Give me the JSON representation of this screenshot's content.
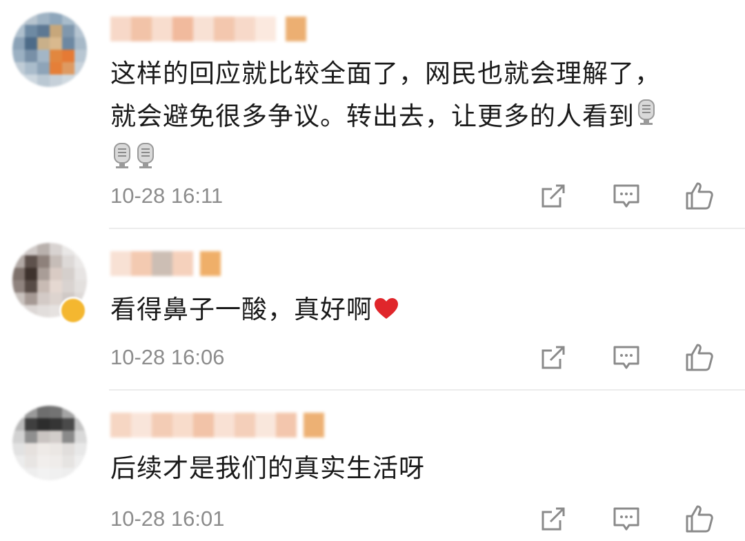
{
  "comments": [
    {
      "text_line1": "这样的回应就比较全面了，网民也就会理解了，",
      "text_line2": "就会避免很多争议。转出去，让更多的人看到",
      "mic_emoji_count": 3,
      "time": "10-28 16:11"
    },
    {
      "text": "看得鼻子一酸，真好啊",
      "emoji": "heart",
      "time": "10-28 16:06"
    },
    {
      "text": "后续才是我们的真实生活呀",
      "time": "10-28 16:01"
    }
  ],
  "icons": {
    "share": "share-icon",
    "comment": "comment-icon",
    "like": "like-icon"
  },
  "colors": {
    "text": "#1a1a1a",
    "time": "#8c8c8c",
    "icon": "#8a8a8a",
    "heart": "#e0262b",
    "badge": "#f4b730"
  }
}
